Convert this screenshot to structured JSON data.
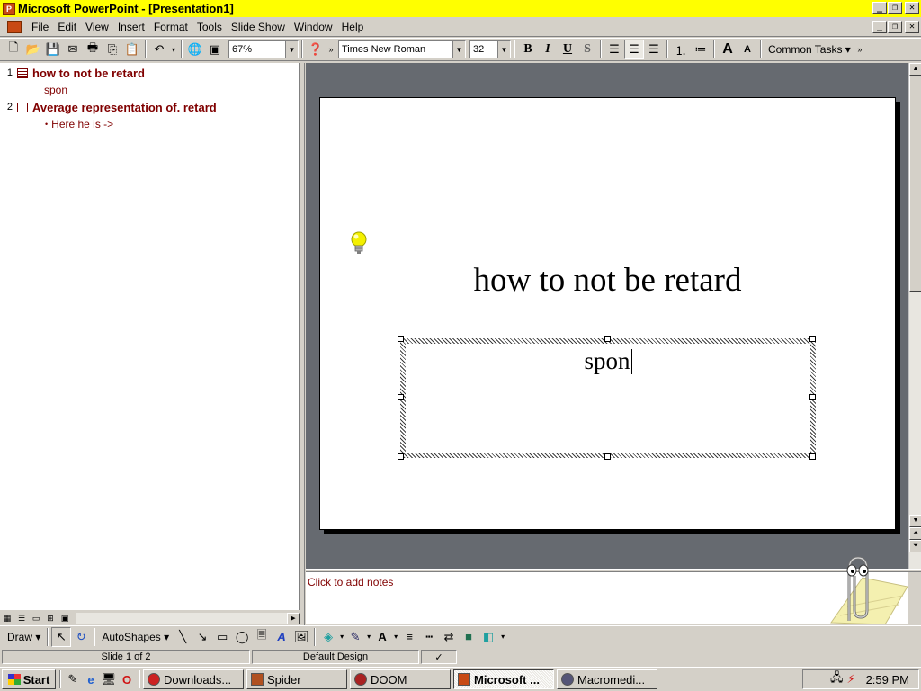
{
  "window": {
    "title": "Microsoft PowerPoint - [Presentation1]",
    "controls": {
      "minimize": "_",
      "restore": "❐",
      "close": "✕"
    }
  },
  "menu": {
    "items": [
      "File",
      "Edit",
      "View",
      "Insert",
      "Format",
      "Tools",
      "Slide Show",
      "Window",
      "Help"
    ]
  },
  "toolbar": {
    "zoom": "67%",
    "font_name": "Times New Roman",
    "font_size": "32",
    "bold": "B",
    "italic": "I",
    "underline": "U",
    "shadow": "S",
    "common_tasks": "Common Tasks ▾",
    "icons": [
      "new-icon",
      "open-icon",
      "save-icon",
      "email-icon",
      "print-icon",
      "copy-icon",
      "paste-icon",
      "undo-icon",
      "hyperlink-icon",
      "new-slide-icon"
    ]
  },
  "outline": {
    "slides": [
      {
        "number": "1",
        "title": "how to not be retard",
        "bullets": [
          "spon"
        ],
        "bulleted": false
      },
      {
        "number": "2",
        "title": "Average representation of. retard",
        "bullets": [
          "Here he is ->"
        ],
        "bulleted": true
      }
    ]
  },
  "slide": {
    "title": "how to not be retard",
    "subtitle_text": "spon"
  },
  "notes": {
    "placeholder": "Click to add notes"
  },
  "drawing_toolbar": {
    "draw": "Draw ▾",
    "autoshapes": "AutoShapes ▾"
  },
  "status": {
    "slide_position": "Slide 1 of 2",
    "design": "Default Design"
  },
  "taskbar": {
    "start": "Start",
    "tasks": [
      {
        "label": "Downloads...",
        "active": false,
        "color": "#cc2222"
      },
      {
        "label": "Spider",
        "active": false,
        "color": "#b05020"
      },
      {
        "label": "DOOM",
        "active": false,
        "color": "#aa2222"
      },
      {
        "label": "Microsoft ...",
        "active": true,
        "color": "#c84a14"
      },
      {
        "label": "Macromedi...",
        "active": false,
        "color": "#555577"
      }
    ],
    "clock": "2:59 PM"
  },
  "colors": {
    "titlebar": "#ffff00",
    "outline_text": "#800000",
    "slide_pane_bg": "#666a70"
  }
}
